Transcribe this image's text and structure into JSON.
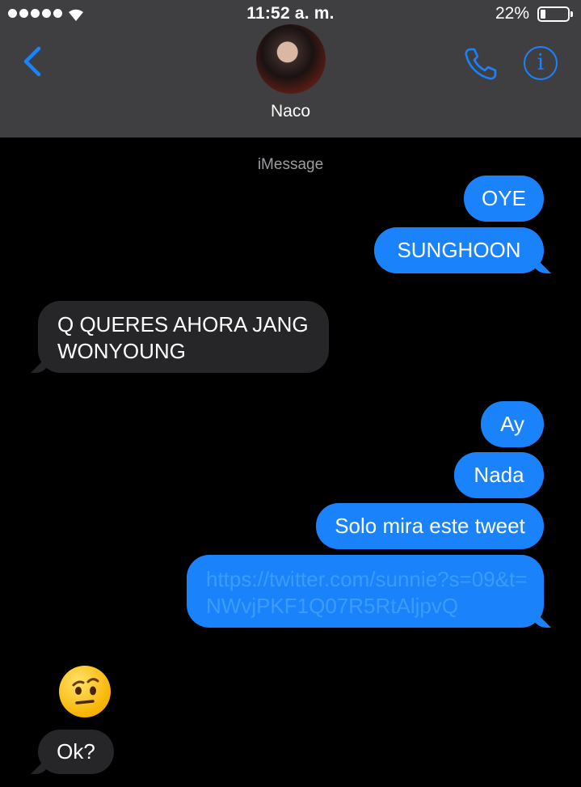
{
  "status_bar": {
    "time": "11:52 a. m.",
    "battery_percent": "22%",
    "battery_level": 0.22,
    "signal_bars": 5
  },
  "header": {
    "contact_name": "Naco",
    "service_label": "iMessage"
  },
  "icons": {
    "back": "chevron-left-icon",
    "phone": "phone-icon",
    "info": "info-icon",
    "wifi": "wifi-icon",
    "battery": "battery-icon"
  },
  "colors": {
    "accent": "#1a82fb",
    "outgoing_bubble": "#1a82fb",
    "incoming_bubble": "#262628",
    "header_bg": "#3f3f41",
    "link": "#3b9bff"
  },
  "messages": [
    {
      "side": "out",
      "text": "OYE"
    },
    {
      "side": "out",
      "text": "SUNGHOON"
    },
    {
      "side": "in",
      "text": "Q QUERES AHORA JANG WONYOUNG"
    },
    {
      "side": "out",
      "text": "Ay"
    },
    {
      "side": "out",
      "text": "Nada"
    },
    {
      "side": "out",
      "text": "Solo mira este tweet"
    },
    {
      "side": "out",
      "text": "https://twitter.com/sunnie?s=09&t=NWvjPKF1Q07R5RtAljpvQ"
    },
    {
      "side": "in",
      "text": "🤨"
    },
    {
      "side": "in",
      "text": "Ok?"
    }
  ]
}
